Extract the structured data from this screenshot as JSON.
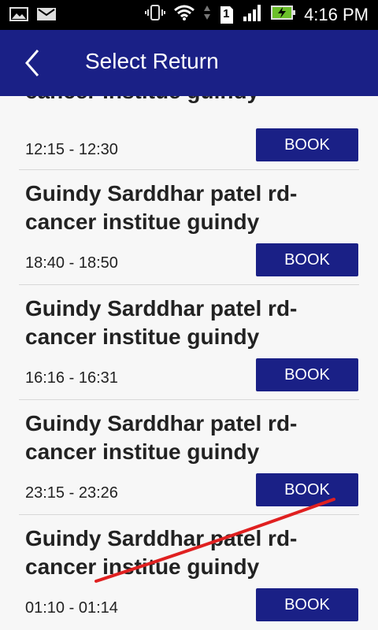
{
  "status_bar": {
    "time": "4:16 PM",
    "sim_slot": "1"
  },
  "header": {
    "title": "Select Return",
    "back_icon": "chevron-left-icon"
  },
  "trips": [
    {
      "route": "Guindy Sarddhar patel rd- cancer institue guindy",
      "time": "12:15 - 12:30",
      "button": "BOOK"
    },
    {
      "route": "Guindy Sarddhar patel rd- cancer institue guindy",
      "time": "18:40 - 18:50",
      "button": "BOOK"
    },
    {
      "route": "Guindy Sarddhar patel rd- cancer institue guindy",
      "time": "16:16 - 16:31",
      "button": "BOOK"
    },
    {
      "route": "Guindy Sarddhar patel rd- cancer institue guindy",
      "time": "23:15 - 23:26",
      "button": "BOOK"
    },
    {
      "route": "Guindy Sarddhar patel rd- cancer institue guindy",
      "time": "01:10 - 01:14",
      "button": "BOOK"
    }
  ],
  "colors": {
    "primary": "#1a2086",
    "status_bar": "#000000",
    "background": "#f7f7f7",
    "annotation_stroke": "#e02020"
  }
}
